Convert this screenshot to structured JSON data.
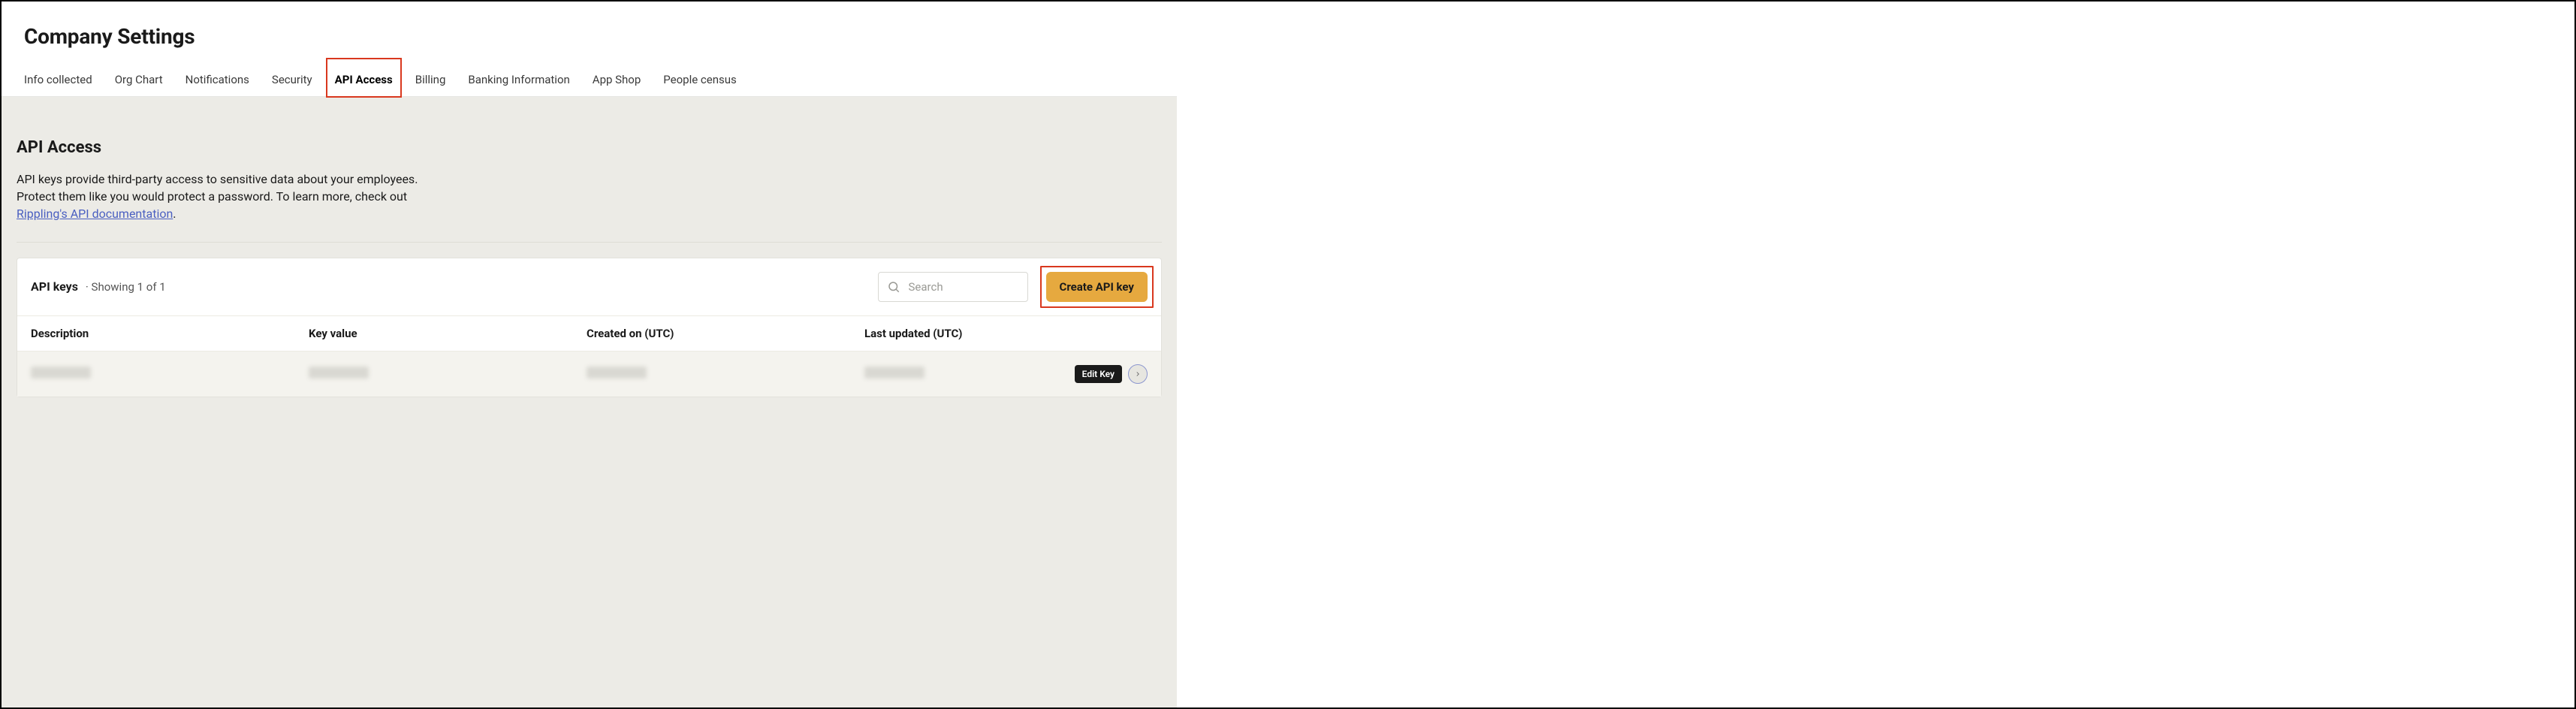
{
  "page": {
    "title": "Company Settings"
  },
  "tabs": [
    {
      "label": "Info collected"
    },
    {
      "label": "Org Chart"
    },
    {
      "label": "Notifications"
    },
    {
      "label": "Security"
    },
    {
      "label": "API Access",
      "active": true
    },
    {
      "label": "Billing"
    },
    {
      "label": "Banking Information"
    },
    {
      "label": "App Shop"
    },
    {
      "label": "People census"
    }
  ],
  "section": {
    "heading": "API Access",
    "desc_line1": "API keys provide third-party access to sensitive data about your employees.",
    "desc_line2_pre": "Protect them like you would protect a password. To learn more, check out ",
    "doc_link": "Rippling's API documentation",
    "desc_line2_post": "."
  },
  "card": {
    "title": "API keys",
    "sub": "· Showing 1 of 1",
    "search_placeholder": "Search",
    "create_label": "Create API key"
  },
  "table": {
    "headers": {
      "description": "Description",
      "key_value": "Key value",
      "created_on": "Created on (UTC)",
      "last_updated": "Last updated (UTC)"
    },
    "row_action_label": "Edit Key"
  }
}
